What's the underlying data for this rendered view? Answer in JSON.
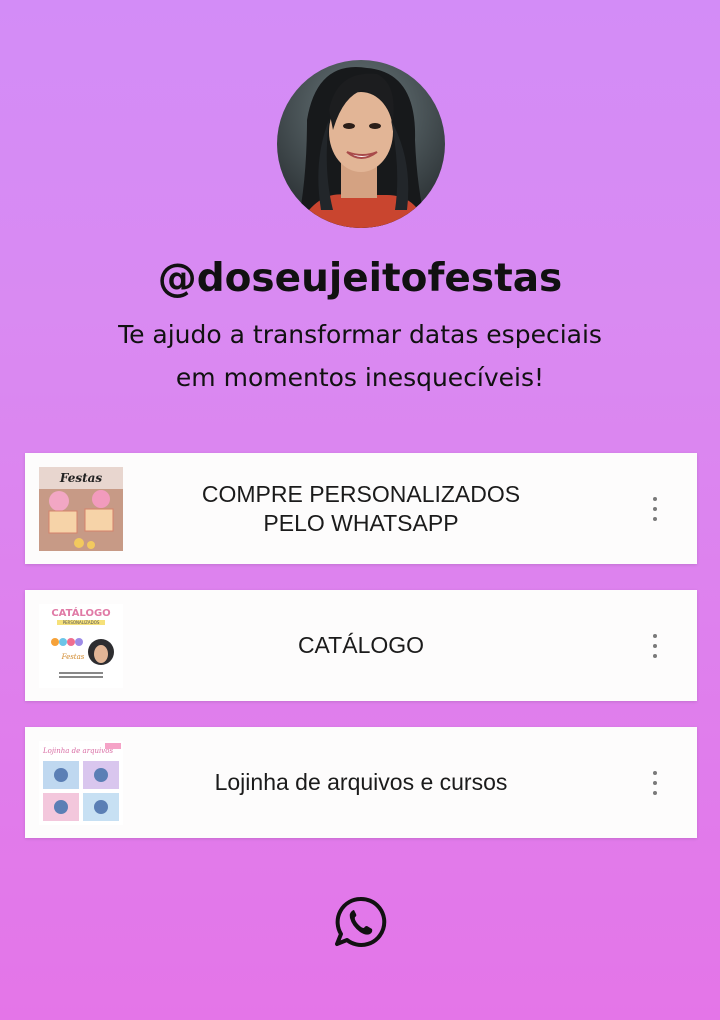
{
  "profile": {
    "handle": "@doseujeitofestas",
    "bio_line1": "Te ajudo a transformar datas especiais",
    "bio_line2": "em momentos inesquecíveis!",
    "avatar_alt": "profile photo"
  },
  "links": [
    {
      "label_line1": "COMPRE PERSONALIZADOS",
      "label_line2": "PELO WHATSAPP",
      "thumb_text": "Festas",
      "more_icon": "more-vertical-icon"
    },
    {
      "label_line1": "CATÁLOGO",
      "thumb_title": "CATÁLOGO",
      "thumb_sub": "PERSONALIZADOS",
      "thumb_name": "Festas",
      "more_icon": "more-vertical-icon"
    },
    {
      "label_line1": "Lojinha de arquivos e cursos",
      "thumb_text": "Lojinha de arquivos",
      "more_icon": "more-vertical-icon"
    }
  ],
  "social": {
    "icon": "whatsapp-icon"
  },
  "colors": {
    "bg_top": "#d38cf7",
    "bg_bottom": "#e475e8",
    "card_bg": "#fdfcfc",
    "text": "#111111"
  }
}
